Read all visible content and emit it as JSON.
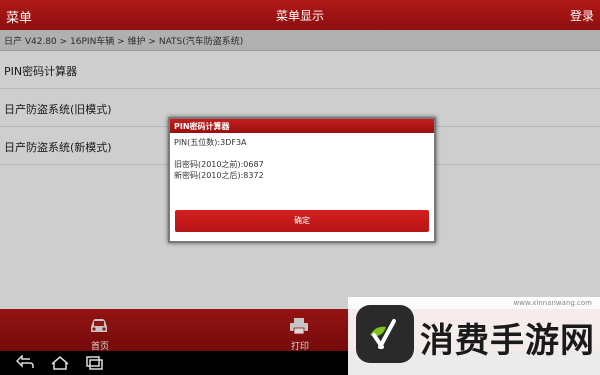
{
  "header": {
    "menu_label": "菜单",
    "title": "菜单显示",
    "login_label": "登录"
  },
  "breadcrumb": "日产 V42.80 > 16PIN车辆 > 维护 > NATS(汽车防盗系统)",
  "list": {
    "items": [
      {
        "label": "PIN密码计算器"
      },
      {
        "label": "日产防盗系统(旧模式)"
      },
      {
        "label": "日产防盗系统(新模式)"
      }
    ]
  },
  "dialog": {
    "title": "PIN密码计算器",
    "pin_line": "PIN(五位数):3DF3A",
    "old_code_line": "旧密码(2010之前):0687",
    "new_code_line": "新密码(2010之后):8372",
    "ok_label": "确定"
  },
  "toolbar": {
    "home_label": "首页",
    "print_label": "打印"
  },
  "watermark": {
    "url": "www.xinnanwang.com",
    "text": "消费手游网"
  },
  "colors": {
    "header_red": "#a31414",
    "button_red": "#c81b1b"
  },
  "icons": {
    "home": "car-icon",
    "print": "printer-icon",
    "back": "back-icon",
    "home_nav": "home-icon",
    "recent": "recent-apps-icon"
  }
}
